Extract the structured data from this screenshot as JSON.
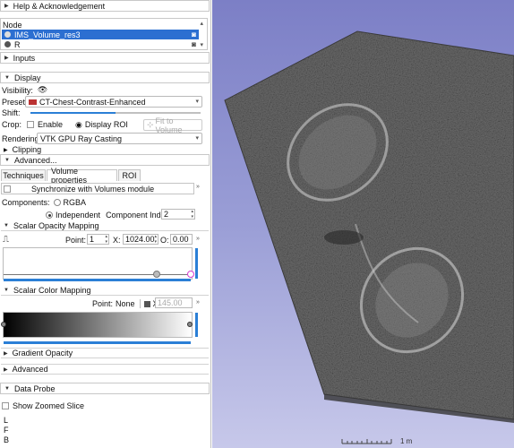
{
  "help_section": {
    "label": "Help & Acknowledgement"
  },
  "node_list": {
    "header": "Node",
    "items": [
      {
        "label": "IMS_Volume_res3",
        "selected": true
      },
      {
        "label": "R",
        "selected": false
      }
    ]
  },
  "inputs_section": {
    "label": "Inputs"
  },
  "display_section": {
    "label": "Display",
    "visibility_label": "Visibility:",
    "preset_label": "Preset:",
    "preset_value": "CT-Chest-Contrast-Enhanced",
    "shift_label": "Shift:",
    "crop_label": "Crop:",
    "enable_label": "Enable",
    "display_roi_label": "Display ROI",
    "fit_to_volume_label": "Fit to Volume",
    "rendering_label": "Rendering:",
    "rendering_value": "VTK GPU Ray Casting",
    "clipping_label": "Clipping"
  },
  "advanced_section": {
    "label": "Advanced...",
    "tabs": [
      "Techniques",
      "Volume properties",
      "ROI"
    ],
    "active_tab": "Volume properties",
    "sync_label": "Synchronize with Volumes module",
    "components_label": "Components:",
    "rgba_label": "RGBA",
    "independent_label": "Independent",
    "component_index_label": "Component Index:",
    "component_index_value": "2"
  },
  "scalar_opacity": {
    "label": "Scalar Opacity Mapping",
    "point_label": "Point:",
    "point_value": "1",
    "x_label": "X:",
    "x_value": "1024.00",
    "o_label": "O:",
    "o_value": "0.00"
  },
  "scalar_color": {
    "label": "Scalar Color Mapping",
    "point_label": "Point:",
    "point_value": "None",
    "x_label": "X:",
    "x_value": "145.00"
  },
  "gradient_opacity": {
    "label": "Gradient Opacity"
  },
  "advanced2": {
    "label": "Advanced"
  },
  "data_probe": {
    "label": "Data Probe",
    "show_zoomed_label": "Show Zoomed Slice",
    "lines": [
      "L",
      "F",
      "B"
    ]
  },
  "view3d": {
    "scale_label": "1 m",
    "background_top": "#7c7fc6",
    "background_bottom": "#c7c8ea"
  },
  "colors": {
    "accent": "#2b7fd6",
    "selection": "#2c6fd1",
    "opacity_point_highlight": "#d63bd0"
  }
}
